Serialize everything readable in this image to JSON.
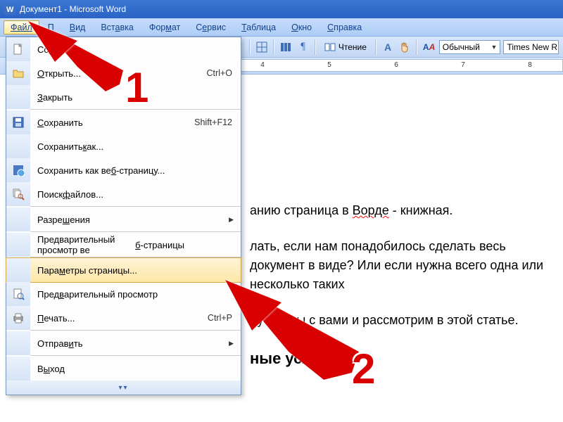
{
  "window": {
    "title": "Документ1 - Microsoft Word"
  },
  "menubar": {
    "file": "Файл",
    "items_rest": [
      "П",
      "Вид",
      "Вставка",
      "Формат",
      "Сервис",
      "Таблица",
      "Окно",
      "Справка"
    ]
  },
  "toolbar": {
    "read_label": "Чтение",
    "style_value": "Обычный",
    "font_value": "Times New R"
  },
  "ruler": {
    "numbers": [
      "4",
      "5",
      "6",
      "7",
      "8"
    ]
  },
  "file_menu": {
    "create": "Создать",
    "open": "Открыть...",
    "open_short": "Ctrl+O",
    "close": "Закрыть",
    "save": "Сохранить",
    "save_short": "Shift+F12",
    "save_as": "Сохранить как...",
    "save_as_web": "Сохранить как веб-страницу...",
    "file_search": "Поиск файлов...",
    "permissions": "Разрешения",
    "web_preview": "Предварительный просмотр веб-страницы",
    "page_setup": "Параметры страницы...",
    "print_preview": "Предварительный просмотр",
    "print": "Печать...",
    "print_short": "Ctrl+P",
    "send": "Отправить",
    "exit": "Выход"
  },
  "annotations": {
    "one": "1",
    "two": "2"
  },
  "document": {
    "p1_a": "анию страница в ",
    "p1_word": "Ворде",
    "p1_b": " - книжная.",
    "p2": "лать, если нам понадобилось сделать весь документ в виде? Или если нужна всего одна или несколько таких",
    "p3": "лучаи мы с вами и рассмотрим в этой статье.",
    "h2": "ные условия"
  }
}
